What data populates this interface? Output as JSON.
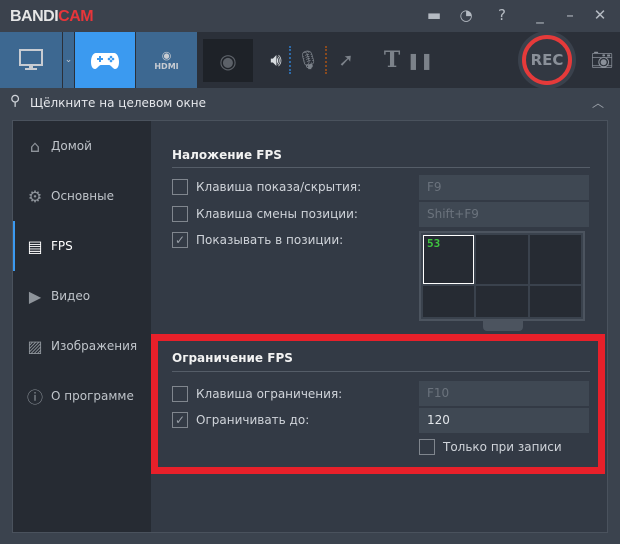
{
  "app": {
    "logo_left": "BANDI",
    "logo_right": "CAM"
  },
  "titlebar": {
    "icons": [
      "folder-icon",
      "clock-icon",
      "help-icon",
      "minimize-icon",
      "maximize-icon",
      "close-icon"
    ],
    "help": "?",
    "close": "✕"
  },
  "toolbar": {
    "modes": [
      "screen-mode",
      "game-mode",
      "hdmi-mode"
    ],
    "hdmi_label": "HDMI",
    "rec_label": "REC",
    "text_tool": "T",
    "pause": "❚❚"
  },
  "search": {
    "label": "Щёлкните на целевом окне"
  },
  "sidebar": {
    "items": [
      {
        "label": "Домой",
        "icon": "home-icon"
      },
      {
        "label": "Основные",
        "icon": "gear-icon"
      },
      {
        "label": "FPS",
        "icon": "fps-icon"
      },
      {
        "label": "Видео",
        "icon": "video-icon"
      },
      {
        "label": "Изображения",
        "icon": "image-icon"
      },
      {
        "label": "О программе",
        "icon": "info-icon"
      }
    ],
    "active": "FPS"
  },
  "overlay": {
    "title": "Наложение FPS",
    "show_hide": {
      "label": "Клавиша показа/скрытия:",
      "checked": false,
      "value": "F9"
    },
    "change_pos": {
      "label": "Клавиша смены позиции:",
      "checked": false,
      "value": "Shift+F9"
    },
    "show_at": {
      "label": "Показывать в позиции:",
      "checked": true
    },
    "fps_sample": "53"
  },
  "limit": {
    "title": "Ограничение FPS",
    "hotkey": {
      "label": "Клавиша ограничения:",
      "checked": false,
      "value": "F10"
    },
    "limit_to": {
      "label": "Ограничивать до:",
      "checked": true,
      "value": "120"
    },
    "record_only": {
      "label": "Только при записи",
      "checked": false
    }
  },
  "colors": {
    "accent": "#3b9af0",
    "rec": "#e53a3a",
    "highlight": "#e8202a",
    "fps_text": "#3fc63f"
  }
}
